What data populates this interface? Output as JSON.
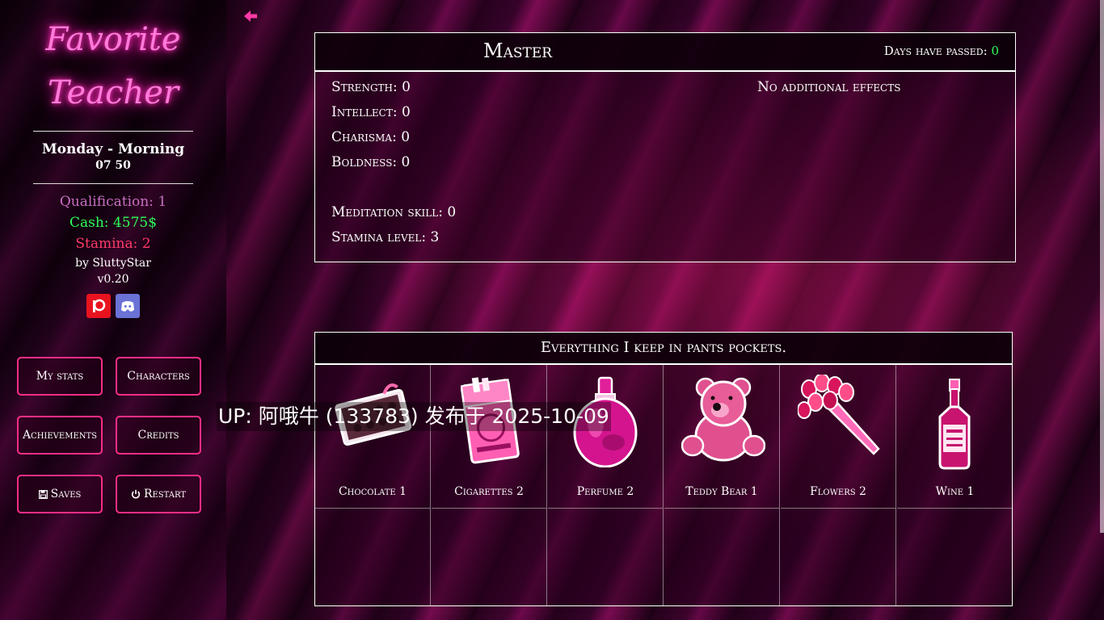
{
  "sidebar": {
    "title_line1": "Favorite",
    "title_line2": "Teacher",
    "day": "Monday - Morning",
    "time": "07 50",
    "qualification": "Qualification: 1",
    "cash": "Cash: 4575$",
    "stamina": "Stamina: 2",
    "author": "by SluttyStar",
    "version": "v0.20"
  },
  "menu": {
    "my_stats": "My stats",
    "characters": "Characters",
    "achievements": "Achievements",
    "credits": "Credits",
    "saves": "Saves",
    "restart": "Restart"
  },
  "master": {
    "name": "Master",
    "days_label": "Days have passed: ",
    "days_value": "0",
    "stats": [
      "Strength: 0",
      "Intellect: 0",
      "Charisma: 0",
      "Boldness: 0",
      "Meditation skill: 0",
      "Stamina level: 3"
    ],
    "effects": "No additional effects"
  },
  "pockets": {
    "heading": "Everything I keep in pants pockets.",
    "items": [
      {
        "label": "Chocolate 1",
        "icon": "chocolate-box-icon"
      },
      {
        "label": "Cigarettes 2",
        "icon": "cigarettes-pack-icon"
      },
      {
        "label": "Perfume 2",
        "icon": "perfume-bottle-icon"
      },
      {
        "label": "Teddy Bear 1",
        "icon": "teddy-bear-icon"
      },
      {
        "label": "Flowers 2",
        "icon": "flowers-bouquet-icon"
      },
      {
        "label": "Wine 1",
        "icon": "bottle-icon"
      }
    ]
  },
  "watermark": "UP: 阿哦牛 (133783) 发布于 2025-10-09",
  "colors": {
    "accent": "#ff2d86",
    "title_glow": "#ff7ad9",
    "cash": "#2dff5a",
    "stamina": "#ff3a68",
    "qualification": "#c86fc2"
  }
}
